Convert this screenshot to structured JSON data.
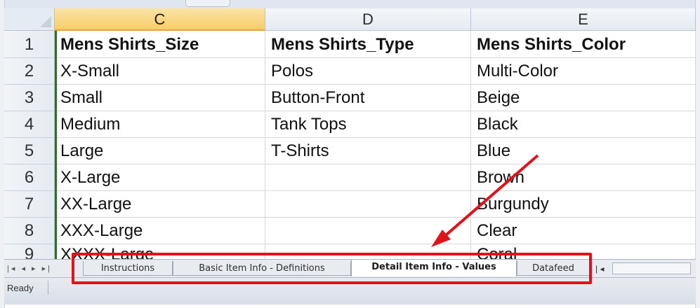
{
  "columns": [
    {
      "letter": "C",
      "selected": true
    },
    {
      "letter": "D",
      "selected": false
    },
    {
      "letter": "E",
      "selected": false
    }
  ],
  "rows": [
    {
      "num": "1",
      "cells": [
        "Mens Shirts_Size",
        "Mens Shirts_Type",
        "Mens Shirts_Color"
      ]
    },
    {
      "num": "2",
      "cells": [
        "X-Small",
        "Polos",
        "Multi-Color"
      ]
    },
    {
      "num": "3",
      "cells": [
        "Small",
        "Button-Front",
        "Beige"
      ]
    },
    {
      "num": "4",
      "cells": [
        "Medium",
        "Tank Tops",
        "Black"
      ]
    },
    {
      "num": "5",
      "cells": [
        "Large",
        "T-Shirts",
        "Blue"
      ]
    },
    {
      "num": "6",
      "cells": [
        "X-Large",
        "",
        "Brown"
      ]
    },
    {
      "num": "7",
      "cells": [
        "XX-Large",
        "",
        "Burgundy"
      ]
    },
    {
      "num": "8",
      "cells": [
        "XXX-Large",
        "",
        "Clear"
      ]
    },
    {
      "num": "9",
      "cells": [
        "XXXX-Large",
        "",
        "Coral"
      ]
    }
  ],
  "sheet_tabs": [
    {
      "label": "Instructions",
      "active": false
    },
    {
      "label": "Basic Item Info - Definitions",
      "active": false
    },
    {
      "label": "Detail Item Info - Values",
      "active": true
    },
    {
      "label": "Datafeed",
      "active": false
    }
  ],
  "tab_nav_icons": [
    "first-sheet-icon",
    "prev-sheet-icon",
    "next-sheet-icon",
    "last-sheet-icon"
  ],
  "status": {
    "text": "Ready"
  },
  "annotation": {
    "box_color": "#e0131a",
    "arrow_color": "#e0131a"
  },
  "colors": {
    "selected_column_header": "#f7cd6a",
    "header_bg": "#e4eaf1"
  }
}
